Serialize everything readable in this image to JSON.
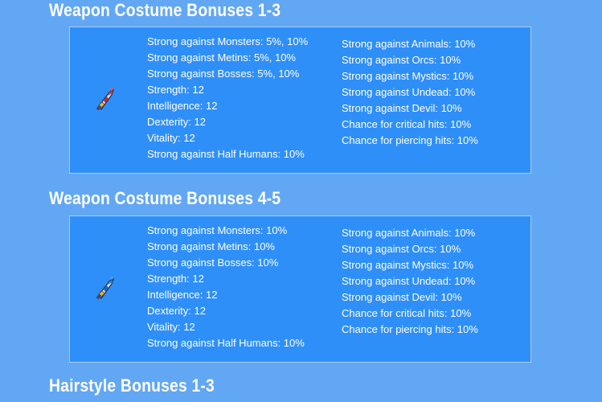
{
  "sections": [
    {
      "title": "Weapon Costume Bonuses 1-3",
      "icon": "weapon-costume-icon",
      "left_bonuses": [
        "Strong against Monsters: 5%, 10%",
        "Strong against Metins: 5%, 10%",
        "Strong against Bosses: 5%, 10%",
        "Strength: 12",
        "Intelligence: 12",
        "Dexterity: 12",
        "Vitality: 12",
        "Strong against Half Humans: 10%"
      ],
      "right_bonuses": [
        "Strong against Animals: 10%",
        "Strong against Orcs: 10%",
        "Strong against Mystics: 10%",
        "Strong against Undead: 10%",
        "Strong against Devil: 10%",
        "Chance for critical hits: 10%",
        "Chance for piercing hits: 10%"
      ]
    },
    {
      "title": "Weapon Costume Bonuses 4-5",
      "icon": "weapon-costume-icon",
      "left_bonuses": [
        "Strong against Monsters: 10%",
        "Strong against Metins: 10%",
        "Strong against Bosses: 10%",
        "Strength: 12",
        "Intelligence: 12",
        "Dexterity: 12",
        "Vitality: 12",
        "Strong against Half Humans: 10%"
      ],
      "right_bonuses": [
        "Strong against Animals: 10%",
        "Strong against Orcs: 10%",
        "Strong against Mystics: 10%",
        "Strong against Undead: 10%",
        "Strong against Devil: 10%",
        "Chance for critical hits: 10%",
        "Chance for piercing hits: 10%"
      ]
    },
    {
      "title": "Hairstyle Bonuses 1-3"
    }
  ],
  "colors": {
    "page_background": "#62a7f3",
    "box_background": "#2f8ff8",
    "box_border": "#a7cdf8",
    "text": "#ffffff"
  }
}
